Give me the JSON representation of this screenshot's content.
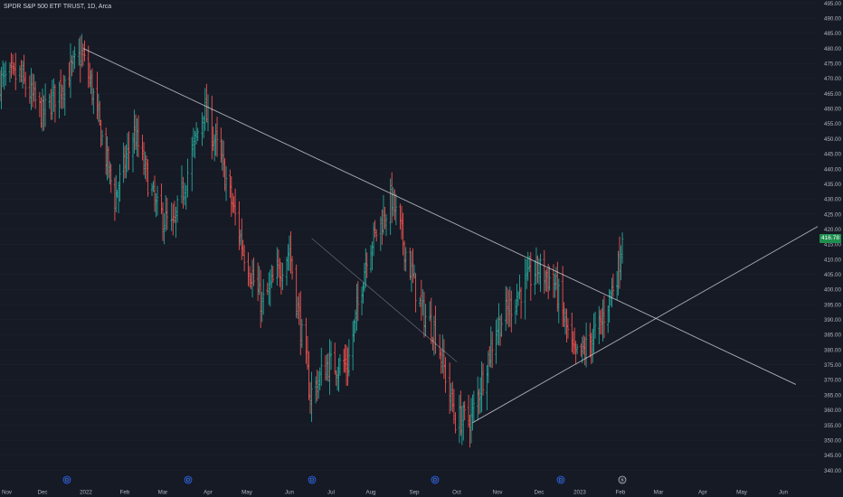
{
  "header": {
    "title": "SPDR S&P 500 ETF TRUST, 1D, Arca"
  },
  "price_scale": {
    "last_price": "416.78",
    "ticks": [
      "495.00",
      "490.00",
      "485.00",
      "480.00",
      "475.00",
      "470.00",
      "465.00",
      "460.00",
      "455.00",
      "450.00",
      "445.00",
      "440.00",
      "435.00",
      "430.00",
      "425.00",
      "420.00",
      "415.00",
      "410.00",
      "405.00",
      "400.00",
      "395.00",
      "390.00",
      "385.00",
      "380.00",
      "375.00",
      "370.00",
      "365.00",
      "360.00",
      "355.00",
      "350.00",
      "345.00",
      "340.00"
    ]
  },
  "time_scale": {
    "labels": [
      "Nov",
      "Dec",
      "2022",
      "Feb",
      "Mar",
      "Apr",
      "May",
      "Jun",
      "Jul",
      "Aug",
      "Sep",
      "Oct",
      "Nov",
      "Dec",
      "2023",
      "Feb",
      "Mar",
      "Apr",
      "May",
      "Jun"
    ]
  },
  "colors": {
    "background": "#161a25",
    "up": "#26a69a",
    "down": "#ef5350",
    "text": "#d1d4dc",
    "grid": "#1f2330",
    "trendline": "#c8cad0",
    "badge": "#1e8f4e"
  },
  "icons": [
    "dividend-icon",
    "dividend-icon",
    "dividend-icon",
    "dividend-icon",
    "dividend-icon",
    "earnings-flash-icon"
  ],
  "chart_data": {
    "type": "ohlc",
    "title": "SPDR S&P 500 ETF TRUST, 1D, Arca",
    "ylim": [
      337,
      497
    ],
    "grid": false,
    "series": [
      {
        "name": "SPY",
        "values": [
          [
            "2021-11-01",
            469
          ],
          [
            "2021-11-15",
            471
          ],
          [
            "2021-12-01",
            458
          ],
          [
            "2021-12-15",
            468
          ],
          [
            "2021-12-29",
            478
          ],
          [
            "2022-01-05",
            468
          ],
          [
            "2022-01-24",
            430
          ],
          [
            "2022-02-08",
            452
          ],
          [
            "2022-02-24",
            427
          ],
          [
            "2022-03-08",
            420
          ],
          [
            "2022-03-29",
            460
          ],
          [
            "2022-04-11",
            443
          ],
          [
            "2022-04-29",
            412
          ],
          [
            "2022-05-12",
            395
          ],
          [
            "2022-06-01",
            413
          ],
          [
            "2022-06-16",
            365
          ],
          [
            "2022-06-28",
            375
          ],
          [
            "2022-07-14",
            375
          ],
          [
            "2022-07-29",
            412
          ],
          [
            "2022-08-16",
            430
          ],
          [
            "2022-09-06",
            393
          ],
          [
            "2022-09-16",
            386
          ],
          [
            "2022-09-30",
            357
          ],
          [
            "2022-10-12",
            357
          ],
          [
            "2022-10-31",
            387
          ],
          [
            "2022-11-15",
            398
          ],
          [
            "2022-11-30",
            407
          ],
          [
            "2022-12-13",
            402
          ],
          [
            "2022-12-28",
            377
          ],
          [
            "2023-01-05",
            380
          ],
          [
            "2023-01-18",
            389
          ],
          [
            "2023-01-31",
            407
          ],
          [
            "2023-02-03",
            416.78
          ]
        ]
      }
    ],
    "trendlines": [
      {
        "name": "descending-trendline",
        "from": [
          "2021-12-30",
          480
        ],
        "to": [
          "2023-06-10",
          368.5
        ]
      },
      {
        "name": "ascending-trendline",
        "from": [
          "2022-10-13",
          355.8
        ],
        "to": [
          "2023-06-30",
          422
        ]
      },
      {
        "name": "inner-descending-line",
        "from": [
          "2022-06-17",
          417
        ],
        "to": [
          "2022-10-01",
          376
        ]
      }
    ]
  }
}
